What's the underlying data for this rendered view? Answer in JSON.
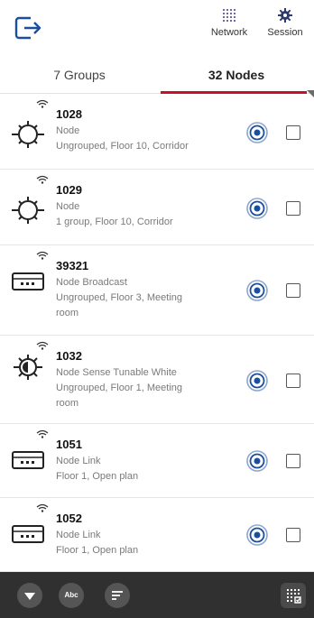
{
  "header": {
    "network_label": "Network",
    "session_label": "Session"
  },
  "tabs": {
    "groups_label": "7 Groups",
    "nodes_label": "32 Nodes",
    "active": "nodes"
  },
  "nodes": [
    {
      "id": "1028",
      "type": "Node",
      "location": [
        "Ungrouped, Floor 10, Corridor"
      ],
      "icon": "ceiling-sensor-icon"
    },
    {
      "id": "1029",
      "type": "Node",
      "location": [
        "1 group, Floor 10, Corridor"
      ],
      "icon": "ceiling-sensor-icon"
    },
    {
      "id": "39321",
      "type": "Node Broadcast",
      "location": [
        "Ungrouped, Floor 3, Meeting",
        "room"
      ],
      "icon": "panel-device-icon"
    },
    {
      "id": "1032",
      "type": "Node Sense Tunable White",
      "location": [
        "Ungrouped, Floor 1, Meeting",
        "room"
      ],
      "icon": "tunable-white-sensor-icon"
    },
    {
      "id": "1051",
      "type": "Node Link",
      "location": [
        "Floor 1, Open plan"
      ],
      "icon": "panel-device-icon"
    },
    {
      "id": "1052",
      "type": "Node Link",
      "location": [
        "Floor 1, Open plan"
      ],
      "icon": "panel-device-icon"
    }
  ],
  "bottombar": {
    "abc_label": "Abc"
  },
  "colors": {
    "accent": "#c8102e",
    "identify_blue": "#1a4fa0",
    "bottombar": "#303030"
  }
}
